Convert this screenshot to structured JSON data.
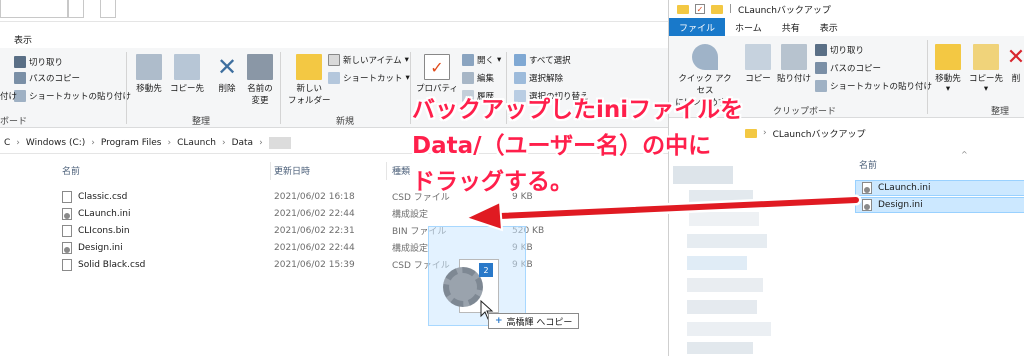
{
  "left_window": {
    "tab_label": "表示",
    "ribbon": {
      "clipboard": {
        "cut": "切り取り",
        "copy_path": "パスのコピー",
        "paste_shortcut": "ショートカットの貼り付け",
        "paste_partial": "付け",
        "group_label": "ボード"
      },
      "organize": {
        "move_to": "移動先",
        "copy_to": "コピー先",
        "delete": "削除",
        "rename_line1": "名前の",
        "rename_line2": "変更",
        "group_label": "整理"
      },
      "new": {
        "new_folder_line1": "新しい",
        "new_folder_line2": "フォルダー",
        "new_item": "新しいアイテム",
        "easy_access": "ショートカット",
        "group_label": "新規"
      },
      "open": {
        "properties": "プロパティ",
        "open": "開く",
        "edit": "編集",
        "history": "履歴"
      },
      "select": {
        "select_all": "すべて選択",
        "select_none": "選択解除",
        "invert": "選択の切り替え"
      }
    },
    "address": {
      "root": "C",
      "parts": [
        "Windows (C:)",
        "Program Files",
        "CLaunch",
        "Data"
      ]
    },
    "columns": {
      "name": "名前",
      "date": "更新日時",
      "type": "種類"
    },
    "files": [
      {
        "name": "Classic.csd",
        "date": "2021/06/02 16:18",
        "type": "CSD ファイル",
        "size": "9 KB",
        "icon": "file-icon"
      },
      {
        "name": "CLaunch.ini",
        "date": "2021/06/02 22:44",
        "type": "構成設定",
        "size": "",
        "icon": "settings-file-icon"
      },
      {
        "name": "CLIcons.bin",
        "date": "2021/06/02 22:31",
        "type": "BIN ファイル",
        "size": "520 KB",
        "icon": "file-icon"
      },
      {
        "name": "Design.ini",
        "date": "2021/06/02 22:44",
        "type": "構成設定",
        "size": "9 KB",
        "icon": "settings-file-icon"
      },
      {
        "name": "Solid Black.csd",
        "date": "2021/06/02 15:39",
        "type": "CSD ファイル",
        "size": "9 KB",
        "icon": "file-icon"
      }
    ]
  },
  "drag": {
    "badge_count": "2",
    "tooltip": "高橋輝 へコピー",
    "plus": "+"
  },
  "right_window": {
    "title": "CLaunchバックアップ",
    "tabs": [
      "ファイル",
      "ホーム",
      "共有",
      "表示"
    ],
    "ribbon": {
      "quick_access_line1": "クイック アクセス",
      "quick_access_line2": "にピン留めする",
      "copy": "コピー",
      "paste": "貼り付け",
      "cut": "切り取り",
      "copy_path": "パスのコピー",
      "paste_shortcut": "ショートカットの貼り付け",
      "move_to": "移動先",
      "copy_to": "コピー先",
      "delete_partial": "削",
      "group_clipboard": "クリップボード",
      "group_organize": "整理"
    },
    "address": "CLaunchバックアップ",
    "column_name": "名前",
    "files": [
      "CLaunch.ini",
      "Design.ini"
    ]
  },
  "annotation": {
    "line1": "バックアップしたiniファイルを",
    "line2": "Data/（ユーザー名）の中に",
    "line3": "ドラッグする。",
    "color": "#ff1f4b"
  },
  "colors": {
    "accent": "#1979ca",
    "selection": "#cce8ff",
    "arrow": "#e01a22"
  }
}
